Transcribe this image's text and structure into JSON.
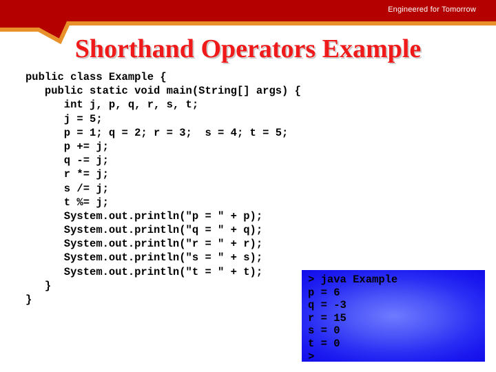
{
  "header": {
    "tagline": "Engineered for Tomorrow",
    "band_color": "#b50000",
    "accent_color": "#e8912a",
    "tagline_color": "#ffffff"
  },
  "title": {
    "text": "Shorthand Operators Example",
    "color": "#f01a1a",
    "shadow_color": "#aaa0a0"
  },
  "code": {
    "language": "java",
    "lines": [
      "public class Example {",
      "   public static void main(String[] args) {",
      "      int j, p, q, r, s, t;",
      "      j = 5;",
      "      p = 1; q = 2; r = 3;  s = 4; t = 5;",
      "      p += j;",
      "      q -= j;",
      "      r *= j;",
      "      s /= j;",
      "      t %= j;",
      "      System.out.println(\"p = \" + p);",
      "      System.out.println(\"q = \" + q);",
      "      System.out.println(\"r = \" + r);",
      "      System.out.println(\"s = \" + s);",
      "      System.out.println(\"t = \" + t);",
      "   }",
      "}"
    ]
  },
  "console": {
    "background_color": "#1a18ef",
    "text_color": "#000000",
    "lines": [
      "> java Example",
      "p = 6",
      "q = -3",
      "r = 15",
      "s = 0",
      "t = 0",
      ">"
    ]
  }
}
